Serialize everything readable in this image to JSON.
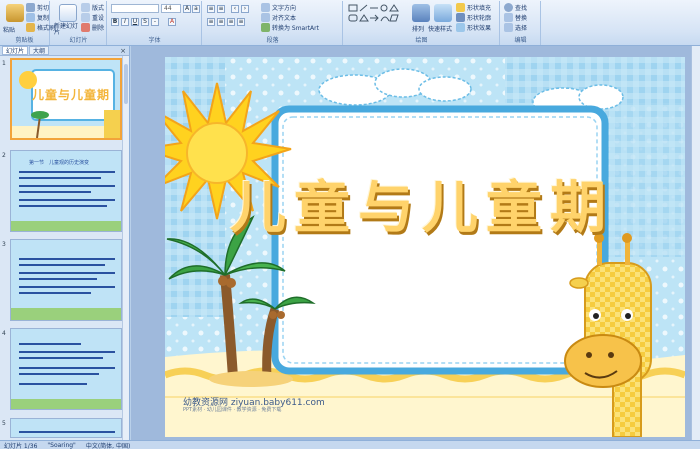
{
  "ribbon": {
    "clipboard": {
      "paste": "粘贴",
      "cut": "剪切",
      "copy": "复制",
      "format": "格式刷",
      "label": "剪贴板"
    },
    "slides": {
      "new": "新建幻灯片",
      "layout": "版式",
      "reset": "重设",
      "delete": "删除",
      "label": "幻灯片"
    },
    "font": {
      "size": "44",
      "label": "字体"
    },
    "paragraph": {
      "text_direction": "文字方向",
      "align_text": "对齐文本",
      "smartart": "转换为 SmartArt",
      "label": "段落"
    },
    "drawing": {
      "arrange": "排列",
      "quick_styles": "快速样式",
      "fill": "形状填充",
      "outline": "形状轮廓",
      "effects": "形状效果",
      "label": "绘图"
    },
    "editing": {
      "find": "查找",
      "replace": "替换",
      "select": "选择",
      "label": "编辑"
    }
  },
  "panel": {
    "tabs": [
      "幻灯片",
      "大纲"
    ],
    "close": "×",
    "slides": [
      {
        "num": "1",
        "title": "儿童与儿童期"
      },
      {
        "num": "2",
        "title": "第一节　儿童观的历史演变"
      },
      {
        "num": "3",
        "title": ""
      },
      {
        "num": "4",
        "title": ""
      },
      {
        "num": "5",
        "title": ""
      }
    ]
  },
  "slide": {
    "title": "儿童与儿童期",
    "watermark": "幼教资源网 ziyuan.baby611.com",
    "watermark_sub": "PPT素材 · 幼儿园课件 · 教学资源 · 免费下载"
  },
  "status": {
    "slide_info": "幻灯片 1/36",
    "theme": "\"Soaring\"",
    "language": "中文(简体, 中国)"
  },
  "colors": {
    "accent": "#f2a33a",
    "ribbon": "#d6e4f5",
    "title": "#ffd36b"
  }
}
